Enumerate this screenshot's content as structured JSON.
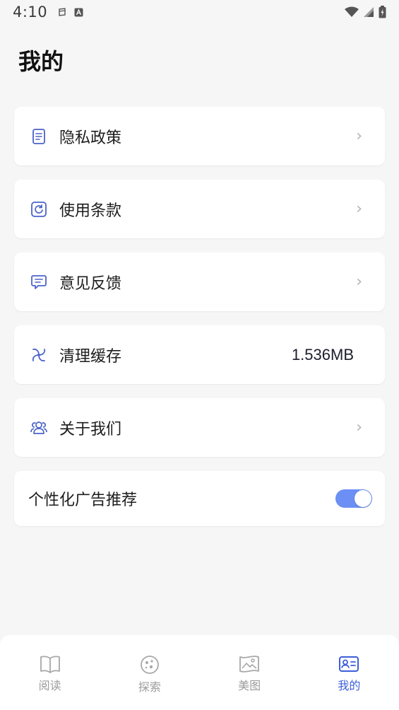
{
  "status_bar": {
    "time": "4:10"
  },
  "page_title": "我的",
  "menu": [
    {
      "label": "隐私政策",
      "icon": "document-icon"
    },
    {
      "label": "使用条款",
      "icon": "refresh-icon"
    },
    {
      "label": "意见反馈",
      "icon": "feedback-icon"
    },
    {
      "label": "清理缓存",
      "icon": "fan-icon",
      "value": "1.536MB"
    },
    {
      "label": "关于我们",
      "icon": "users-icon"
    }
  ],
  "ad_toggle": {
    "label": "个性化广告推荐",
    "enabled": true
  },
  "nav": [
    {
      "label": "阅读",
      "icon": "book-icon"
    },
    {
      "label": "探索",
      "icon": "explore-icon"
    },
    {
      "label": "美图",
      "icon": "image-icon"
    },
    {
      "label": "我的",
      "icon": "profile-card-icon",
      "active": true
    }
  ],
  "colors": {
    "accent": "#3d5fd8",
    "toggle_on": "#6b8ff5",
    "icon_blue": "#4b63c9"
  }
}
